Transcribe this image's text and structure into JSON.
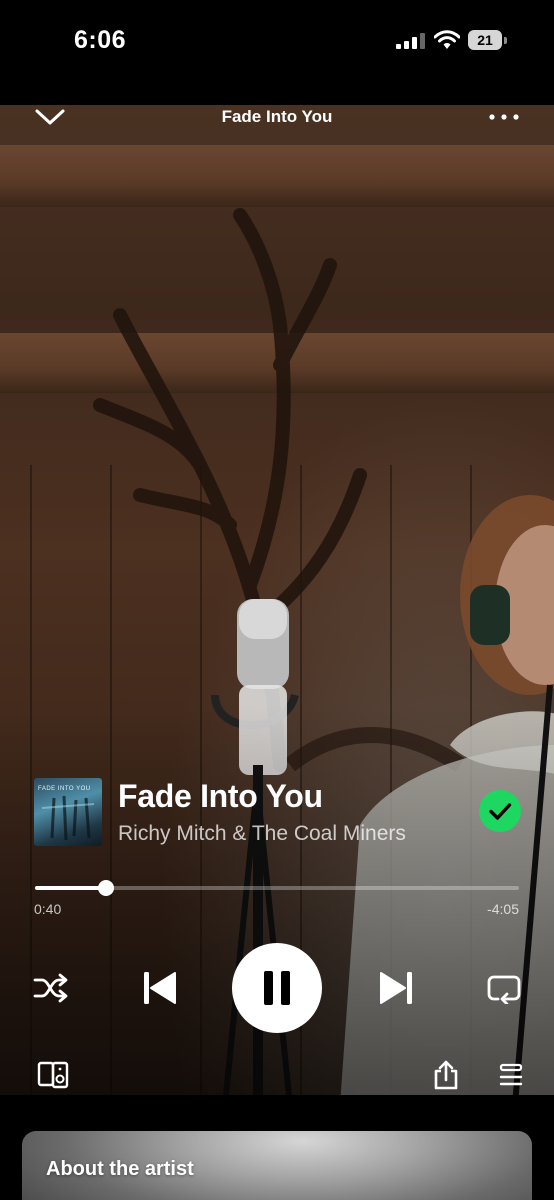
{
  "status_bar": {
    "time": "6:06",
    "battery_level": "21",
    "icons": [
      "signal-icon",
      "wifi-icon",
      "battery-icon"
    ]
  },
  "header": {
    "title": "Fade Into You",
    "icons": [
      "chevron-down-icon",
      "more-dots-icon"
    ]
  },
  "track": {
    "cover_text": "FADE INTO YOU",
    "title": "Fade Into You",
    "artist": "Richy Mitch & The Coal Miners",
    "liked": true
  },
  "playback": {
    "elapsed": "0:40",
    "remaining": "-4:05",
    "progress_fraction": 0.147,
    "state": "playing"
  },
  "controls": {
    "icons": [
      "shuffle-icon",
      "previous-icon",
      "pause-icon",
      "next-icon",
      "repeat-icon",
      "connect-device-icon",
      "share-icon",
      "queue-icon"
    ]
  },
  "about": {
    "title": "About the artist"
  },
  "colors": {
    "accent": "#1ed760",
    "background": "#000000"
  }
}
